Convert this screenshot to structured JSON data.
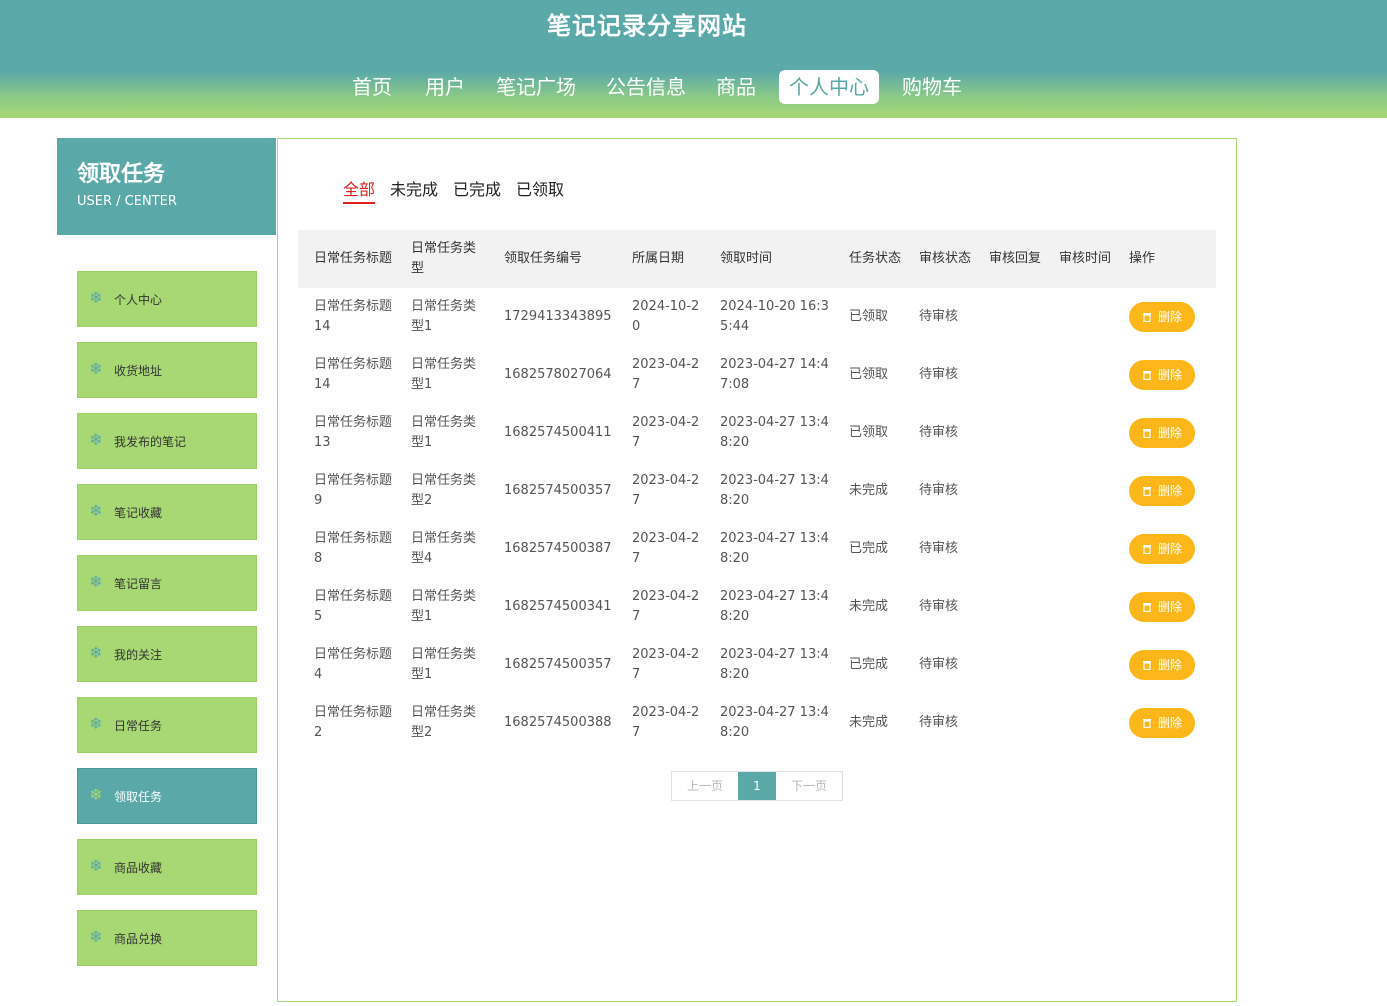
{
  "site": {
    "title": "笔记记录分享网站"
  },
  "nav": [
    "首页",
    "用户",
    "笔记广场",
    "公告信息",
    "商品",
    "个人中心",
    "购物车"
  ],
  "nav_active": "个人中心",
  "sidebar": {
    "title": "领取任务",
    "subtitle": "USER / CENTER",
    "items": [
      {
        "label": "个人中心"
      },
      {
        "label": "收货地址"
      },
      {
        "label": "我发布的笔记"
      },
      {
        "label": "笔记收藏"
      },
      {
        "label": "笔记留言"
      },
      {
        "label": "我的关注"
      },
      {
        "label": "日常任务"
      },
      {
        "label": "领取任务"
      },
      {
        "label": "商品收藏"
      },
      {
        "label": "商品兑换"
      }
    ],
    "active": "领取任务",
    "icon": "snowflake-icon"
  },
  "filters": [
    "全部",
    "未完成",
    "已完成",
    "已领取"
  ],
  "filter_active": "全部",
  "table": {
    "headers": [
      "日常任务标题",
      "日常任务类型",
      "领取任务编号",
      "所属日期",
      "领取时间",
      "任务状态",
      "审核状态",
      "审核回复",
      "审核时间",
      "操作"
    ],
    "rows": [
      [
        "日常任务标题14",
        "日常任务类型1",
        "1729413343895",
        "2024-10-20",
        "2024-10-20 16:35:44",
        "已领取",
        "待审核",
        "",
        ""
      ],
      [
        "日常任务标题14",
        "日常任务类型1",
        "1682578027064",
        "2023-04-27",
        "2023-04-27 14:47:08",
        "已领取",
        "待审核",
        "",
        ""
      ],
      [
        "日常任务标题13",
        "日常任务类型1",
        "1682574500411",
        "2023-04-27",
        "2023-04-27 13:48:20",
        "已领取",
        "待审核",
        "",
        ""
      ],
      [
        "日常任务标题9",
        "日常任务类型2",
        "1682574500357",
        "2023-04-27",
        "2023-04-27 13:48:20",
        "未完成",
        "待审核",
        "",
        ""
      ],
      [
        "日常任务标题8",
        "日常任务类型4",
        "1682574500387",
        "2023-04-27",
        "2023-04-27 13:48:20",
        "已完成",
        "待审核",
        "",
        ""
      ],
      [
        "日常任务标题5",
        "日常任务类型1",
        "1682574500341",
        "2023-04-27",
        "2023-04-27 13:48:20",
        "未完成",
        "待审核",
        "",
        ""
      ],
      [
        "日常任务标题4",
        "日常任务类型1",
        "1682574500357",
        "2023-04-27",
        "2023-04-27 13:48:20",
        "已完成",
        "待审核",
        "",
        ""
      ],
      [
        "日常任务标题2",
        "日常任务类型2",
        "1682574500388",
        "2023-04-27",
        "2023-04-27 13:48:20",
        "未完成",
        "待审核",
        "",
        ""
      ]
    ],
    "delete_label": "删除"
  },
  "pager": {
    "prev": "上一页",
    "current": "1",
    "next": "下一页"
  },
  "colors": {
    "teal": "#5aa8a8",
    "green": "#a7d873",
    "button": "#fdb71a",
    "active_filter": "#e02020"
  }
}
